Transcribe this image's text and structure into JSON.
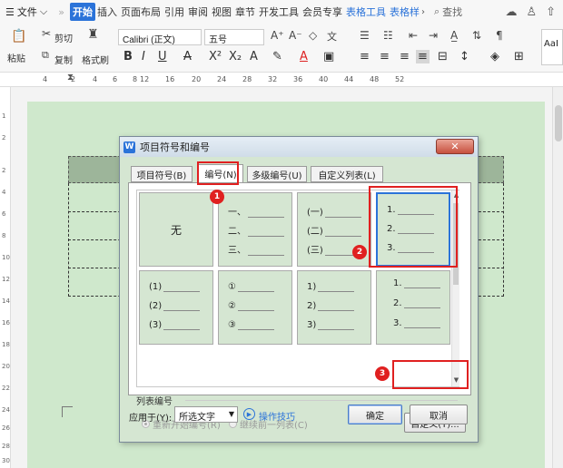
{
  "menubar": {
    "file": "文件",
    "more": "»",
    "tabs": [
      "开始",
      "插入",
      "页面布局",
      "引用",
      "审阅",
      "视图",
      "章节",
      "开发工具",
      "会员专享",
      "表格工具",
      "表格样"
    ],
    "search": "查找"
  },
  "ribbon": {
    "paste": "粘贴",
    "cut": "剪切",
    "copy": "复制",
    "format_painter": "格式刷",
    "font_name": "Calibri (正文)",
    "font_size": "五号",
    "style_preview": "AaI"
  },
  "ruler": {
    "ticks": [
      "4",
      "2",
      "4",
      "6",
      "8",
      "12",
      "16",
      "20",
      "24",
      "28",
      "32",
      "36",
      "40",
      "44",
      "48",
      "52"
    ],
    "vticks": [
      "1",
      "2",
      "2",
      "4",
      "6",
      "8",
      "10",
      "12",
      "14",
      "16",
      "18",
      "20",
      "22",
      "24",
      "26",
      "28",
      "30"
    ]
  },
  "dialog": {
    "title": "项目符号和编号",
    "close": "✕",
    "tabs": [
      "项目符号(B)",
      "编号(N)",
      "多级编号(U)",
      "自定义列表(L)"
    ],
    "none_label": "无",
    "styles": [
      [
        "一、",
        "二、",
        "三、"
      ],
      [
        "(一)",
        "(二)",
        "(三)"
      ],
      [
        "1.",
        "2.",
        "3."
      ],
      [
        "(1)",
        "(2)",
        "(3)"
      ],
      [
        "①",
        "②",
        "③"
      ],
      [
        "1)",
        "2)",
        "3)"
      ],
      [
        "1.",
        "2.",
        "3."
      ]
    ],
    "list_numbering_label": "列表编号",
    "restart_label": "重新开始编号(R)",
    "continue_label": "继续前一列表(C)",
    "customize_button": "自定义(T)...",
    "apply_to_label": "应用于(Y):",
    "apply_to_value": "所选文字",
    "tips_link": "操作技巧",
    "ok_button": "确定",
    "cancel_button": "取消"
  },
  "annotations": [
    "1",
    "2",
    "3"
  ],
  "colors": {
    "accent": "#2b73d9",
    "annotation_red": "#e02020",
    "page_green": "#cfe8cc"
  }
}
